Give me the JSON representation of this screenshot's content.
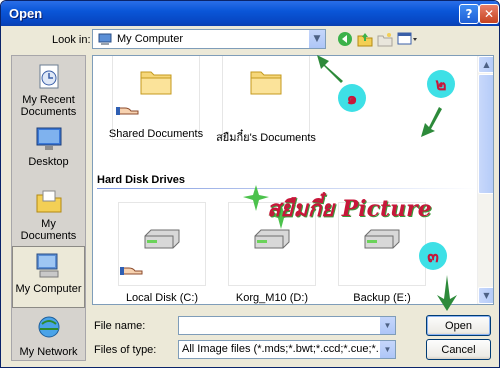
{
  "window": {
    "title": "Open"
  },
  "titlebar": {
    "help_glyph": "?",
    "close_glyph": "✕"
  },
  "lookin": {
    "label": "Look in:",
    "value": "My Computer"
  },
  "places": [
    {
      "label": "My Recent Documents",
      "icon": "recent-documents-icon"
    },
    {
      "label": "Desktop",
      "icon": "desktop-icon"
    },
    {
      "label": "My Documents",
      "icon": "my-documents-icon"
    },
    {
      "label": "My Computer",
      "icon": "my-computer-icon",
      "selected": true
    },
    {
      "label": "My Network",
      "icon": "my-network-icon"
    }
  ],
  "filelist": {
    "folders": [
      {
        "label": "Shared Documents",
        "shared": true
      },
      {
        "label": "สยืมกี๋ย's Documents",
        "shared": false
      }
    ],
    "section_header": "Hard Disk Drives",
    "drives": [
      {
        "label": "Local Disk (C:)",
        "shared": true
      },
      {
        "label": "Korg_M10 (D:)",
        "shared": false
      },
      {
        "label": "Backup (E:)",
        "shared": false
      }
    ]
  },
  "overlay": {
    "watermark": "สยืมกี๋ย Picture",
    "numbers": [
      "๑",
      "๒",
      "๓"
    ],
    "accent": "#3ee0e6",
    "text_color": "#c7173a"
  },
  "filename": {
    "label": "File name:",
    "value": ""
  },
  "filetype": {
    "label": "Files of type:",
    "value": "All Image files (*.mds;*.bwt;*.ccd;*.cue;*.cdi;*.pdi"
  },
  "buttons": {
    "open": "Open",
    "cancel": "Cancel"
  }
}
